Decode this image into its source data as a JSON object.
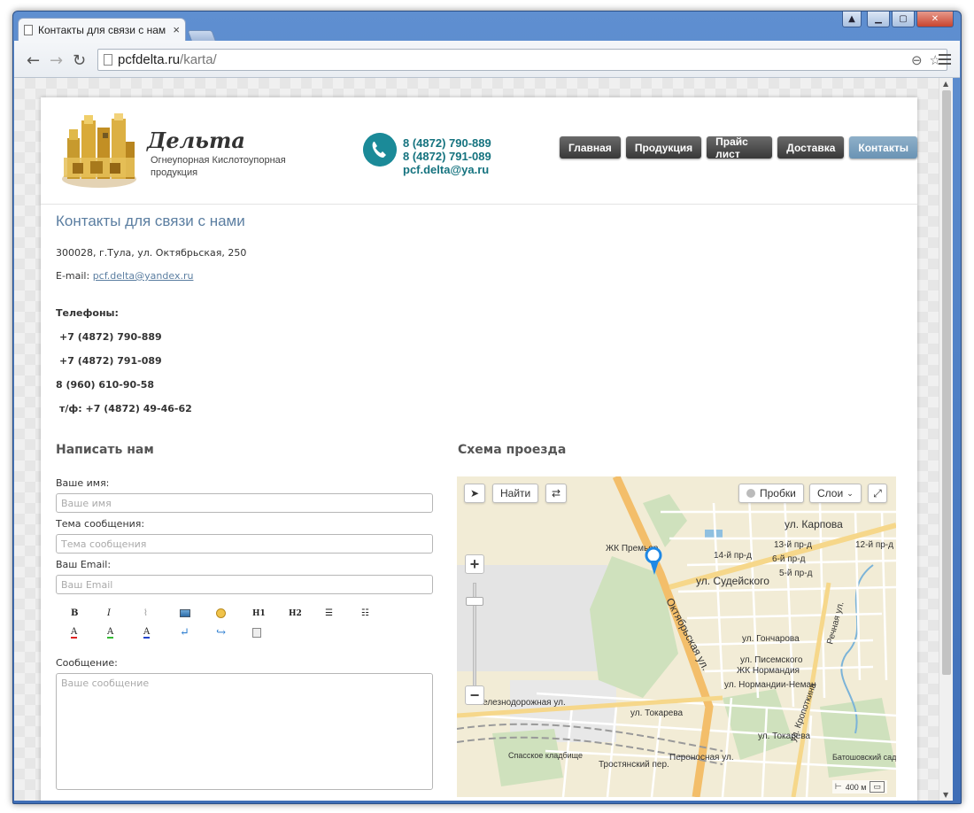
{
  "browser": {
    "tab_title": "Контакты для связи с нам",
    "url_host": "pcfdelta.ru",
    "url_path": "/karta/"
  },
  "header": {
    "brand_name": "Дельта",
    "brand_subtitle": "Огнеупорная Кислотоупорная продукция",
    "phone_1": "8 (4872) 790-889",
    "phone_2": "8 (4872) 791-089",
    "email": "pcf.delta@ya.ru",
    "accent_color": "#1b8a98"
  },
  "nav": {
    "items": [
      {
        "label": "Главная"
      },
      {
        "label": "Продукция"
      },
      {
        "label": "Прайс лист"
      },
      {
        "label": "Доставка"
      },
      {
        "label": "Контакты"
      }
    ]
  },
  "content": {
    "title": "Контакты для связи с нами",
    "address": "300028, г.Тула, ул. Октябрьская, 250",
    "email_label": "E-mail:",
    "email_value": "pcf.delta@yandex.ru",
    "phones_heading": "Телефоны:",
    "phones": [
      "+7 (4872) 790-889",
      "+7 (4872) 791-089",
      "8 (960) 610-90-58",
      "т/ф: +7 (4872) 49-46-62"
    ]
  },
  "form": {
    "heading": "Написать нам",
    "name_label": "Ваше имя:",
    "name_placeholder": "Ваше имя",
    "subject_label": "Тема сообщения:",
    "subject_placeholder": "Тема сообщения",
    "email_label": "Ваш Email:",
    "email_placeholder": "Ваш Email",
    "message_label": "Сообщение:",
    "message_placeholder": "Ваше сообщение",
    "toolbar": {
      "bold": "B",
      "italic": "I",
      "h1": "H1",
      "h2": "H2",
      "font_color": "A",
      "highlight": "A",
      "bg_color": "A"
    }
  },
  "map": {
    "heading": "Схема проезда",
    "find_label": "Найти",
    "traffic_label": "Пробки",
    "layers_label": "Слои",
    "scale_label": "400 м",
    "street_labels": [
      "ул. Карпова",
      "ул. Судейского",
      "Октябрьская ул.",
      "ул. Токарева",
      "ул. Гончарова",
      "ул. Писемского",
      "ул. Нормандии-Неман",
      "ЖК Нормандия",
      "ЖК Премьер",
      "Железнодорожная ул.",
      "Спасское кладбище",
      "Тростянский пер.",
      "Переносная ул.",
      "Батошовский сад",
      "ул. Кропоткина",
      "Речная ул.",
      "14-й пр-д",
      "13-й пр-д",
      "6-й пр-д",
      "5-й пр-д",
      "12-й пр-д",
      "ул. Токарева"
    ]
  }
}
